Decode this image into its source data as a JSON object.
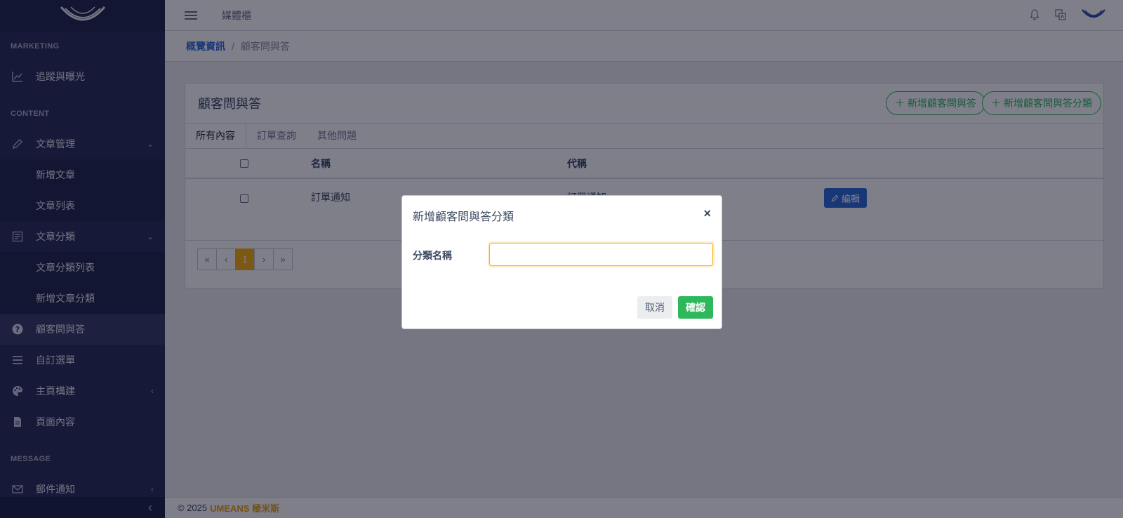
{
  "header": {
    "nav_link": "媒體櫃"
  },
  "breadcrumb": {
    "home": "概覽資訊",
    "separator": "/",
    "current": "顧客問與答"
  },
  "sidebar": {
    "sections": [
      {
        "title": "MARKETING"
      },
      {
        "title": "CONTENT"
      },
      {
        "title": "MESSAGE"
      }
    ],
    "items": {
      "tracking": "追蹤與曝光",
      "article_mgmt": "文章管理",
      "article_new": "新增文章",
      "article_list": "文章列表",
      "article_category": "文章分類",
      "article_category_list": "文章分類列表",
      "article_category_new": "新增文章分類",
      "faq": "顧客問與答",
      "custom_menu": "自訂選單",
      "homepage_builder": "主頁構建",
      "page_content": "頁面內容",
      "mail_notify": "郵件通知"
    }
  },
  "card": {
    "title": "顧客問與答",
    "add_faq_button": "新增顧客問與答",
    "add_faq_category_button": "新增顧客問與答分類",
    "tabs": [
      "所有內容",
      "訂單查詢",
      "其他問題"
    ],
    "columns": {
      "name": "名稱",
      "code": "代稱"
    },
    "rows": [
      {
        "name": "訂單通知",
        "code": "訂單通知",
        "action": "編輯"
      }
    ],
    "pagination": {
      "first": "«",
      "prev": "‹",
      "current": "1",
      "next": "›",
      "last": "»"
    }
  },
  "footer": {
    "copyright": "© 2025",
    "brand": "UMEANS 極米斯"
  },
  "modal": {
    "title": "新增顧客問與答分類",
    "close": "×",
    "field_label": "分類名稱",
    "field_value": "",
    "cancel": "取消",
    "confirm": "確認"
  },
  "colors": {
    "sidebar_bg": "#2c3359",
    "accent_blue": "#2f6fd6",
    "success_green": "#2eb85c",
    "warning_yellow": "#f9b115",
    "brand_orange": "#e8a317"
  },
  "icons": {
    "tracking": "chart-line-icon",
    "article_mgmt": "pencil-icon",
    "article_category": "list-icon",
    "faq": "question-circle-icon",
    "custom_menu": "menu-lines-icon",
    "homepage_builder": "palette-icon",
    "page_content": "file-icon",
    "mail_notify": "envelope-icon"
  }
}
